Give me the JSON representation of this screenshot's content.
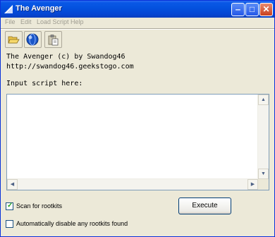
{
  "window": {
    "title": "The Avenger",
    "minimize_glyph": "‒",
    "maximize_glyph": "□",
    "close_glyph": "✕"
  },
  "menu": [
    {
      "label": "File"
    },
    {
      "label": "Edit"
    },
    {
      "label": "Load Script"
    },
    {
      "label": "Help"
    }
  ],
  "toolbar": [
    {
      "icon": "folder-open-icon"
    },
    {
      "icon": "globe-icon"
    },
    {
      "icon": "paste-icon"
    }
  ],
  "info": {
    "line1": "The Avenger (c) by Swandog46",
    "line2": "http://swandog46.geekstogo.com",
    "prompt": "Input script here:"
  },
  "script_input": {
    "value": ""
  },
  "options": {
    "scan_label": "Scan for rootkits",
    "scan_checked": true,
    "disable_label": "Automatically disable any rootkits found",
    "disable_checked": false
  },
  "execute_label": "Execute"
}
